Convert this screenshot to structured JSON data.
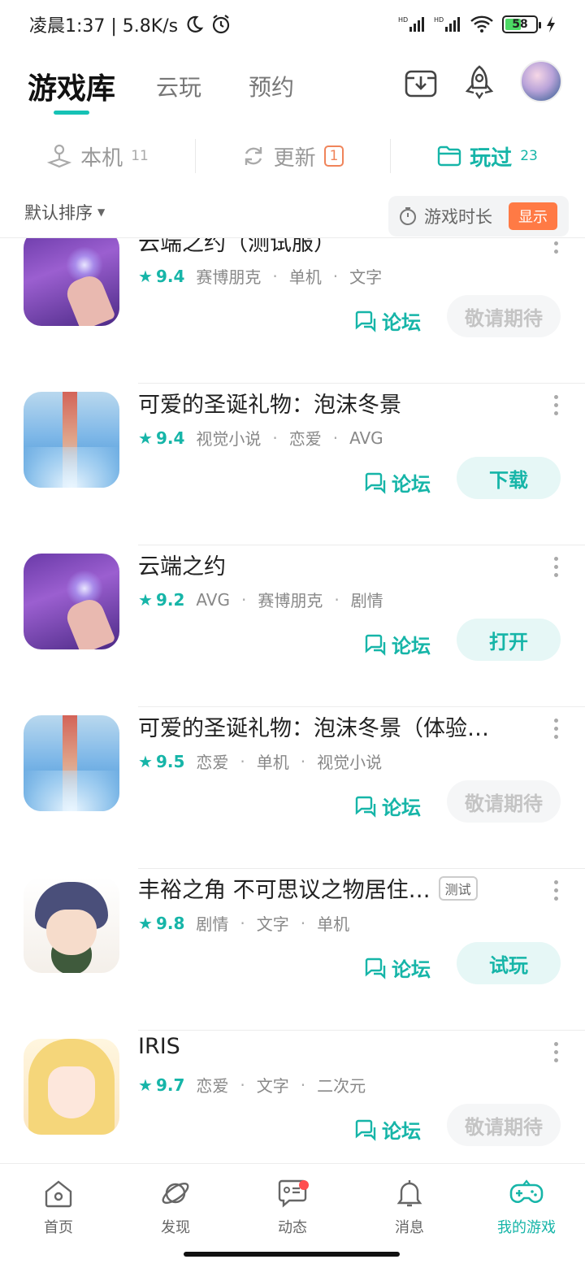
{
  "status_bar": {
    "time_speed": "凌晨1:37 | 5.8K/s",
    "battery": "58",
    "battery_level": 0.58
  },
  "header": {
    "tabs": [
      {
        "label": "游戏库",
        "active": true
      },
      {
        "label": "云玩",
        "active": false
      },
      {
        "label": "预约",
        "active": false
      }
    ]
  },
  "segments": [
    {
      "label": "本机",
      "count": "11",
      "active": false
    },
    {
      "label": "更新",
      "badge": "1",
      "active": false
    },
    {
      "label": "玩过",
      "count": "23",
      "active": true
    }
  ],
  "sort": {
    "label": "默认排序"
  },
  "duration": {
    "label": "游戏时长",
    "button": "显示"
  },
  "forum_label": "论坛",
  "games": [
    {
      "title": "云端之约（测试服）",
      "score": "9.4",
      "tags": [
        "赛博朋克",
        "单机",
        "文字"
      ],
      "action": "敬请期待",
      "action_style": "disabled",
      "thumb": "purple"
    },
    {
      "title": "可爱的圣诞礼物：泡沫冬景",
      "score": "9.4",
      "tags": [
        "视觉小说",
        "恋爱",
        "AVG"
      ],
      "action": "下载",
      "action_style": "primary",
      "thumb": "blue"
    },
    {
      "title": "云端之约",
      "score": "9.2",
      "tags": [
        "AVG",
        "赛博朋克",
        "剧情"
      ],
      "action": "打开",
      "action_style": "primary",
      "thumb": "purple"
    },
    {
      "title": "可爱的圣诞礼物：泡沫冬景（体验…",
      "score": "9.5",
      "tags": [
        "恋爱",
        "单机",
        "视觉小说"
      ],
      "action": "敬请期待",
      "action_style": "disabled",
      "thumb": "blue"
    },
    {
      "title": "丰裕之角 不可思议之物居住…",
      "badge": "测试",
      "score": "9.8",
      "tags": [
        "剧情",
        "文字",
        "单机"
      ],
      "action": "试玩",
      "action_style": "primary",
      "thumb": "boy"
    },
    {
      "title": "IRIS",
      "score": "9.7",
      "tags": [
        "恋爱",
        "文字",
        "二次元"
      ],
      "action": "敬请期待",
      "action_style": "disabled",
      "thumb": "girl"
    }
  ],
  "bottom_nav": [
    {
      "label": "首页",
      "icon": "home-icon",
      "active": false
    },
    {
      "label": "发现",
      "icon": "planet-icon",
      "active": false
    },
    {
      "label": "动态",
      "icon": "message-icon",
      "active": false,
      "dot": true
    },
    {
      "label": "消息",
      "icon": "bell-icon",
      "active": false
    },
    {
      "label": "我的游戏",
      "icon": "gamepad-icon",
      "active": true
    }
  ],
  "colors": {
    "accent": "#16b5a8",
    "orange": "#ff7a45",
    "badge_red": "#ff4d4f"
  }
}
